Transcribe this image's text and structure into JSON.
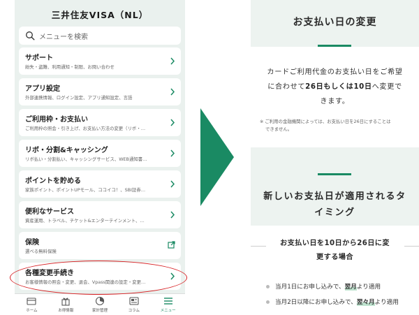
{
  "app": {
    "title": "三井住友VISA（NL）"
  },
  "search": {
    "placeholder": "メニューを検索"
  },
  "menu": [
    {
      "title": "サポート",
      "subtitle": "紛失・盗難、利用通知・制限、お問い合わせ",
      "action": "chevron"
    },
    {
      "title": "アプリ設定",
      "subtitle": "外部連携情報、ログイン設定、アプリ通知設定、言語",
      "action": "chevron"
    },
    {
      "title": "ご利用枠・お支払い",
      "subtitle": "ご利用枠の照会・引き上げ、お支払い方法の変更（リボ・…",
      "action": "chevron"
    },
    {
      "title": "リボ・分割&キャッシング",
      "subtitle": "リボ払い・分割払い、キャッシングサービス、WEB通知書…",
      "action": "chevron"
    },
    {
      "title": "ポイントを貯める",
      "subtitle": "家族ポイント、ポイントUPモール、ココイコ！、SBI証券…",
      "action": "chevron"
    },
    {
      "title": "便利なサービス",
      "subtitle": "資産運用、トラベル、チケット&エンターテインメント、…",
      "action": "chevron"
    },
    {
      "title": "保険",
      "subtitle": "選べる無料保険",
      "action": "external"
    },
    {
      "title": "各種変更手続き",
      "subtitle": "お客様情報の照会・変更、退会、Vpass関連の設定・変更…",
      "action": "chevron"
    }
  ],
  "tabbar": [
    {
      "label": "ホーム",
      "icon": "wallet-icon"
    },
    {
      "label": "お得情報",
      "icon": "gift-icon"
    },
    {
      "label": "家計管理",
      "icon": "pie-chart-icon"
    },
    {
      "label": "コラム",
      "icon": "article-icon"
    },
    {
      "label": "メニュー",
      "icon": "hamburger-icon",
      "active": true
    }
  ],
  "right": {
    "title": "お支払い日の変更",
    "desc_line1": "カードご利用代金のお支払い日をご希望",
    "desc_line2_a": "に合わせて",
    "desc_line2_b": "26日もしくは10日",
    "desc_line2_c": "へ変更で",
    "desc_line3": "きます。",
    "note_line1": "※ ご利用の金融機関によっては、お支払い日を26日にすることは",
    "note_line2": "できません。",
    "section_title_line1": "新しいお支払日が適用されるタ",
    "section_title_line2": "イミング",
    "sub_head_line1": "お支払い日を10日から26日に変",
    "sub_head_line2": "更する場合",
    "bullets": [
      {
        "a": "当月1日にお申し込みで、",
        "b": "翌月",
        "c": "より適用"
      },
      {
        "a": "当月2日以降にお申し込みで、",
        "b": "翌々月",
        "c": "より適用"
      }
    ]
  },
  "colors": {
    "brand_green": "#1a8a63",
    "highlight_red": "#d71f22",
    "panel_bg": "#eaf1ee"
  }
}
